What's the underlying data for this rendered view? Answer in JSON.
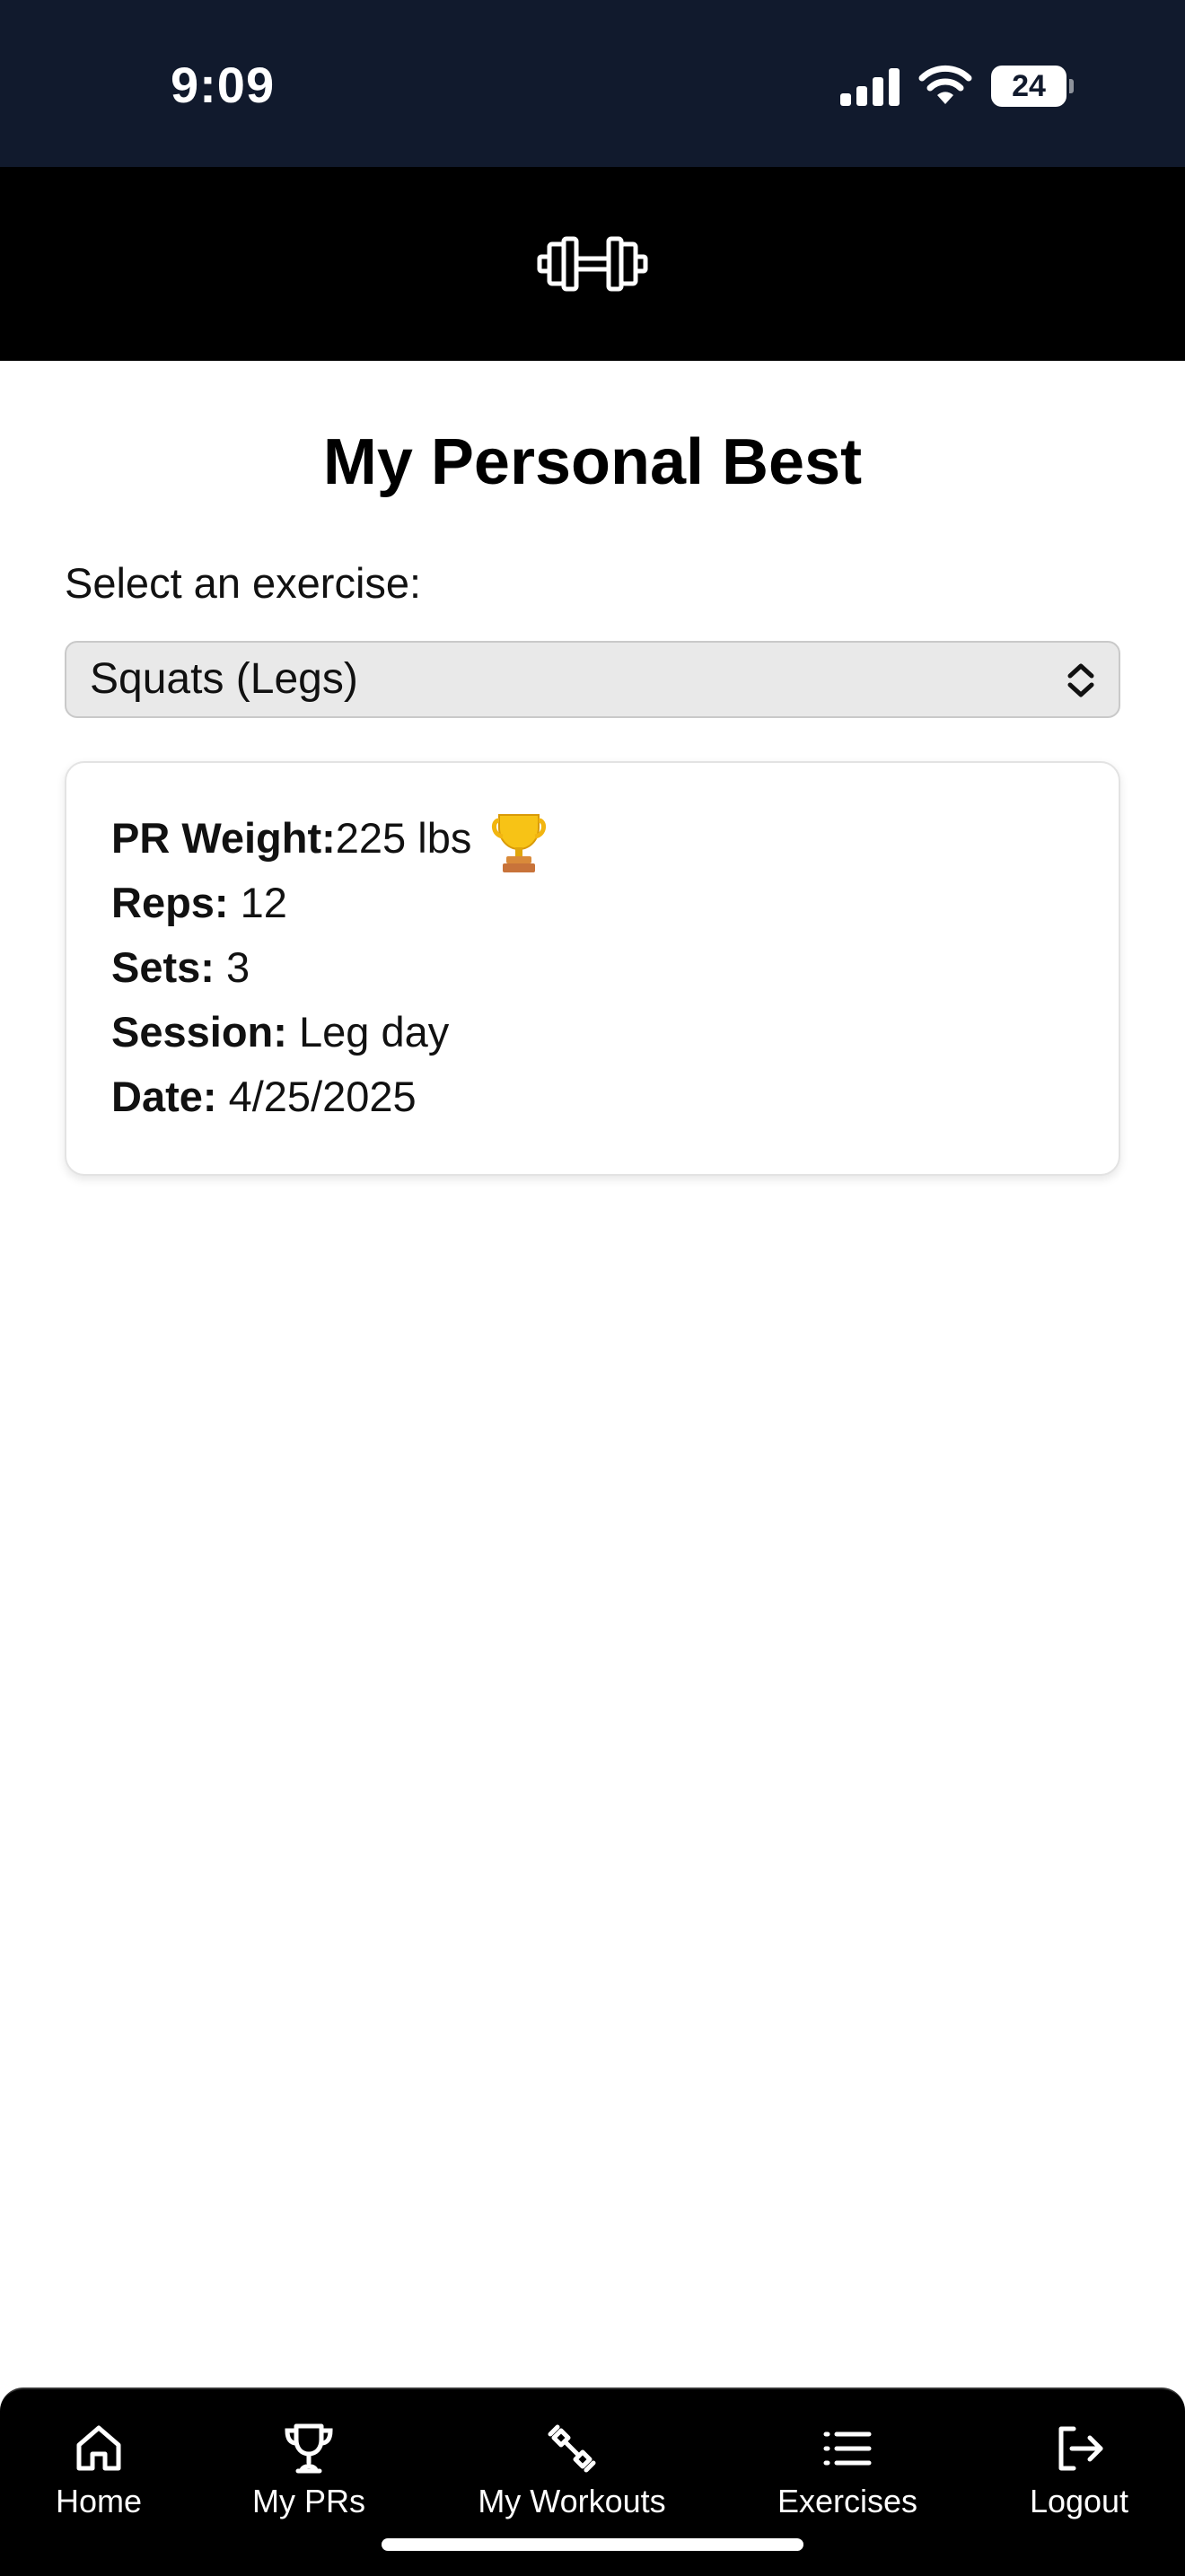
{
  "status_bar": {
    "time": "9:09",
    "battery": "24",
    "icons": [
      "signal-icon",
      "wifi-icon",
      "battery-icon"
    ]
  },
  "header": {
    "logo_icon": "dumbbell-icon"
  },
  "main": {
    "title": "My Personal Best",
    "select_label": "Select an exercise:",
    "selected_exercise": "Squats (Legs)",
    "pr_card": {
      "weight_label": "PR Weight:",
      "weight_value": "225 lbs",
      "trophy": "🏆",
      "reps_label": "Reps:",
      "reps_value": "12",
      "sets_label": "Sets:",
      "sets_value": "3",
      "session_label": "Session:",
      "session_value": "Leg day",
      "date_label": "Date:",
      "date_value": "4/25/2025"
    }
  },
  "nav": {
    "items": [
      {
        "label": "Home",
        "icon": "home-icon"
      },
      {
        "label": "My PRs",
        "icon": "trophy-icon"
      },
      {
        "label": "My Workouts",
        "icon": "dumbbell-icon"
      },
      {
        "label": "Exercises",
        "icon": "list-icon"
      },
      {
        "label": "Logout",
        "icon": "logout-icon"
      }
    ]
  },
  "colors": {
    "status_bar_bg": "#111a2d",
    "header_bg": "#000000",
    "nav_bg": "#000000",
    "select_bg": "#e9e9e9"
  }
}
